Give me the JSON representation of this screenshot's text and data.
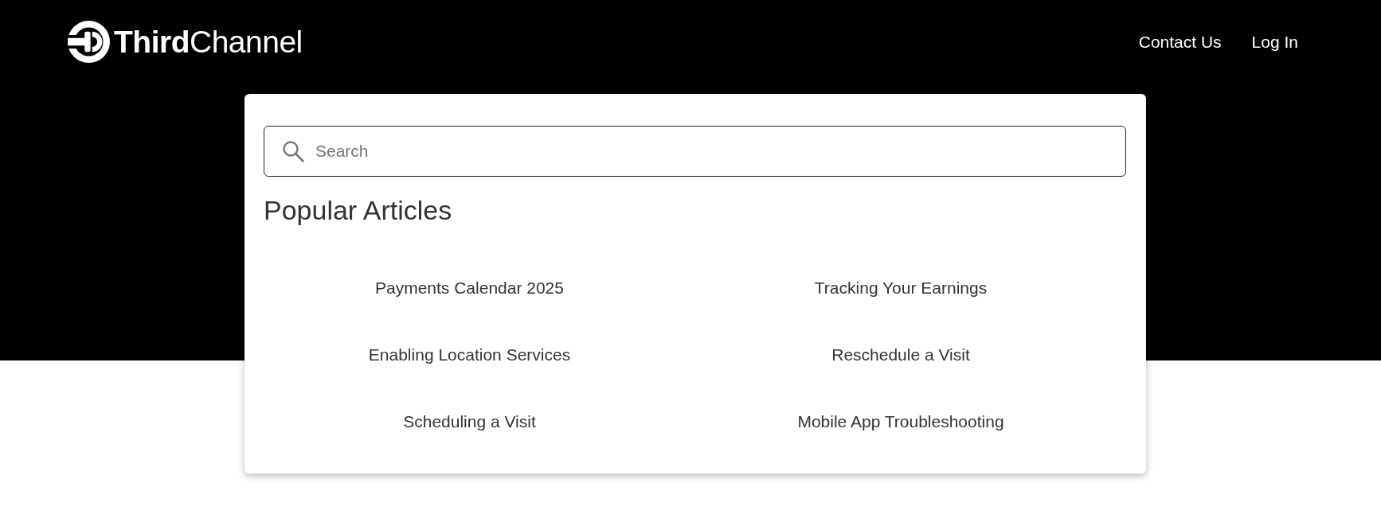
{
  "header": {
    "logo": {
      "text": "**Third**Channel"
    },
    "nav_links": [
      "Contact Us",
      "Log In"
    ]
  },
  "search": {
    "placeholder": "Search"
  },
  "popular_articles": {
    "title": "Popular Articles",
    "articles": [
      "Payments Calendar 2025",
      "Tracking Your Earnings",
      "Enabling Location Services",
      "Reschedule a Visit",
      "Scheduling a Visit",
      "Mobile App Troubleshooting"
    ]
  }
}
